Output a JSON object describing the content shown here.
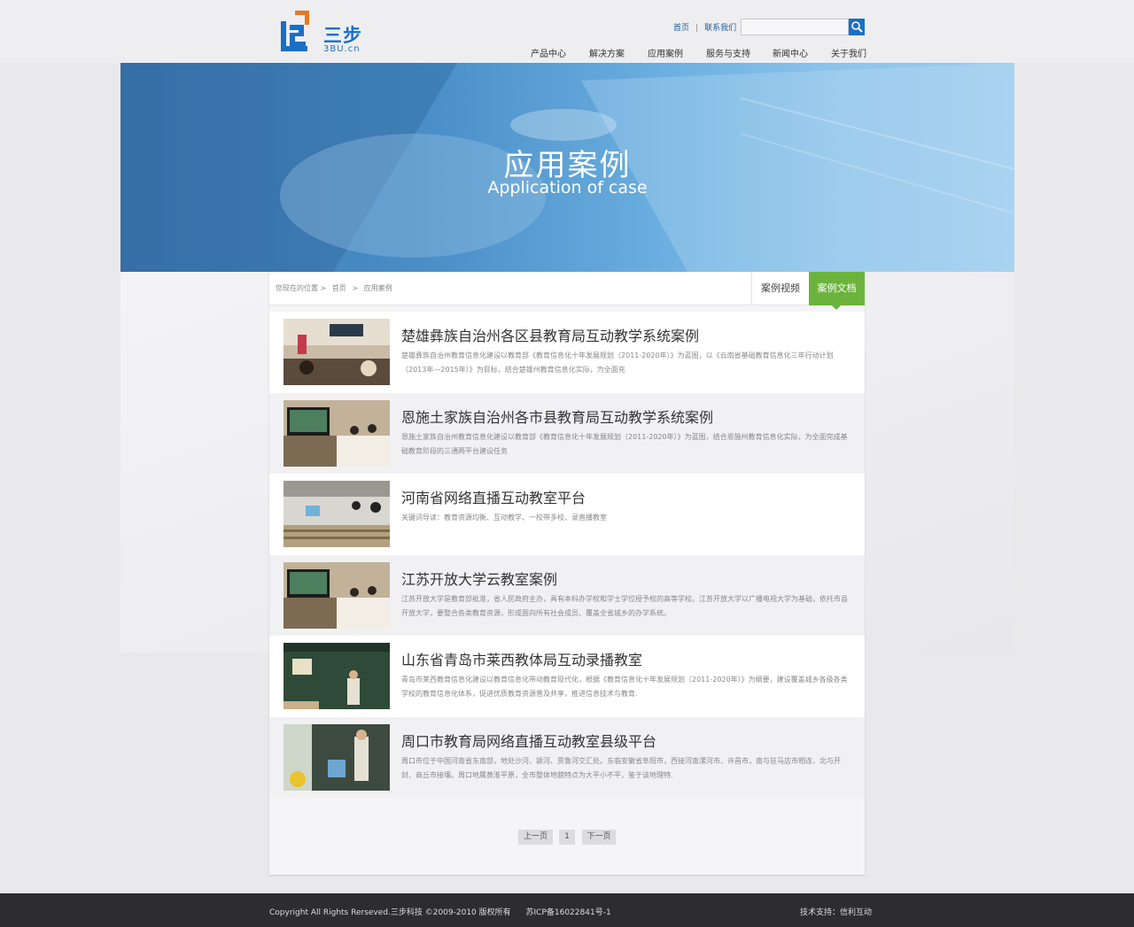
{
  "brand": {
    "name_cn": "三步",
    "name_en": "3BU.cn",
    "colors": {
      "blue": "#1a6fc4",
      "orange": "#e8781e",
      "green": "#6cb33e"
    }
  },
  "toplinks": {
    "home": "首页",
    "contact": "联系我们"
  },
  "search": {
    "placeholder": "",
    "icon": "search-icon"
  },
  "nav": [
    "产品中心",
    "解决方案",
    "应用案例",
    "服务与支持",
    "新闻中心",
    "关于我们"
  ],
  "banner": {
    "title": "应用案例",
    "subtitle": "Application of case"
  },
  "breadcrumb": {
    "label": "您现在的位置 >",
    "home": "首页",
    "sep": ">",
    "current": "应用案例"
  },
  "tabs": {
    "video": "案例视频",
    "doc": "案例文档"
  },
  "cases": [
    {
      "title": "楚雄彝族自治州各区县教育局互动教学系统案例",
      "desc": "楚雄彝族自治州教育信息化建设以教育部《教育信息化十年发展规划（2011-2020年）》为蓝图，以《云南省基础教育信息化三年行动计划（2013年—2015年）》为目标，结合楚雄州教育信息化实际，为全面充"
    },
    {
      "title": "恩施土家族自治州各市县教育局互动教学系统案例",
      "desc": "恩施土家族自治州教育信息化建设以教育部《教育信息化十年发展规划（2011-2020年）》为蓝图，结合恩施州教育信息化实际，为全面完成基础教育阶段的三通两平台建设任务"
    },
    {
      "title": "河南省网络直播互动教室平台",
      "desc": "关键词导读：教育资源均衡、互动教学、一校带多校、录直播教室"
    },
    {
      "title": "江苏开放大学云教室案例",
      "desc": "江苏开放大学是教育部批准，省人民政府主办，具有本科办学权和学士学位授予权的高等学校。江苏开放大学以广播电视大学为基础，依托市县开放大学，要整合各类教育资源，形成面向所有社会成员、覆盖全省城乡的办学系统。"
    },
    {
      "title": "山东省青岛市莱西教体局互动录播教室",
      "desc": "青岛市莱西教育信息化建设以教育信息化带动教育现代化，根据《教育信息化十年发展规划（2011-2020年）》为纲要，建设覆盖城乡各级各类学校的教育信息化体系，促进优质教育资源普及共享，推进信息技术与教育."
    },
    {
      "title": "周口市教育局网络直播互动教室县级平台",
      "desc": "周口市位于中国河南省东南部，地处沙河、颍河、贾鲁河交汇处。东临安徽省阜阳市，西接河南漯河市、许昌市，南与驻马店市相连，北与开封、商丘市接壤。周口地属黄淮平原，全市整体地貌特点为大平小不平，鉴于该地理特."
    }
  ],
  "pager": {
    "prev": "上一页",
    "page": "1",
    "next": "下一页"
  },
  "footer": {
    "copyright": "Copyright All Rights Rerseved.三步科技 ©2009-2010 版权所有",
    "icp": "苏ICP备16022841号-1",
    "support": "技术支持：信利互动"
  }
}
